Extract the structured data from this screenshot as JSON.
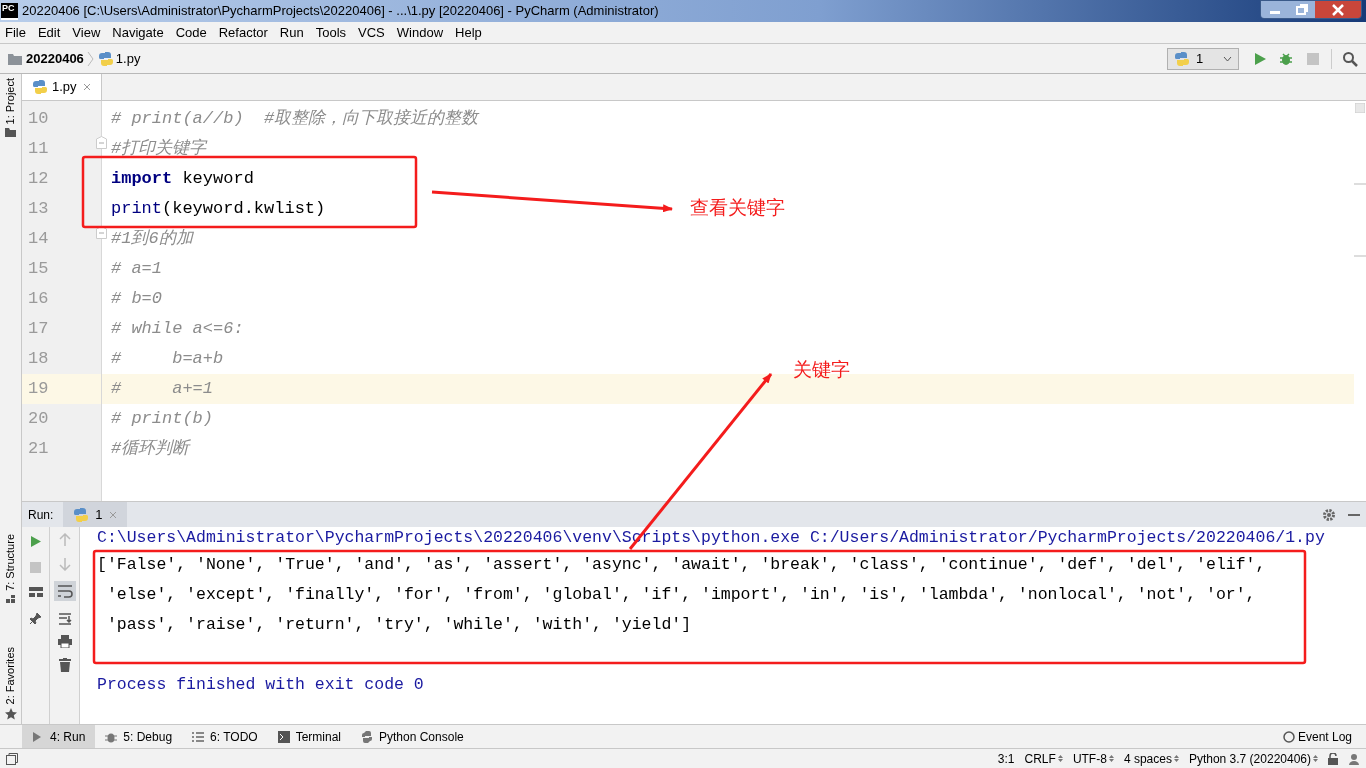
{
  "window": {
    "title": "20220406 [C:\\Users\\Administrator\\PycharmProjects\\20220406] - ...\\1.py [20220406] - PyCharm (Administrator)",
    "app_badge": "PC"
  },
  "menu": [
    "File",
    "Edit",
    "View",
    "Navigate",
    "Code",
    "Refactor",
    "Run",
    "Tools",
    "VCS",
    "Window",
    "Help"
  ],
  "breadcrumb": [
    "20220406",
    "1.py"
  ],
  "run_config": "1",
  "side_tabs_left": [
    {
      "label": "1: Project"
    },
    {
      "label": "7: Structure"
    },
    {
      "label": "2: Favorites"
    }
  ],
  "editor_tabs": [
    {
      "label": "1.py",
      "selected": true
    }
  ],
  "editor": {
    "lines": [
      {
        "number": "10",
        "current": false,
        "fold": false,
        "tokens": [
          {
            "kind": "comment",
            "text": "# print(a//b)  #取整除，向下取接近的整数"
          }
        ]
      },
      {
        "number": "11",
        "current": false,
        "fold": true,
        "tokens": [
          {
            "kind": "comment",
            "text": "#打印关键字"
          }
        ]
      },
      {
        "number": "12",
        "current": false,
        "fold": false,
        "tokens": [
          {
            "kind": "keyword",
            "text": "import"
          },
          {
            "kind": "plain",
            "text": " keyword"
          }
        ]
      },
      {
        "number": "13",
        "current": false,
        "fold": false,
        "tokens": [
          {
            "kind": "builtin",
            "text": "print"
          },
          {
            "kind": "plain",
            "text": "(keyword.kwlist)"
          }
        ]
      },
      {
        "number": "14",
        "current": false,
        "fold": true,
        "tokens": [
          {
            "kind": "comment",
            "text": "#1到6的加"
          }
        ]
      },
      {
        "number": "15",
        "current": false,
        "fold": false,
        "tokens": [
          {
            "kind": "comment",
            "text": "# a=1"
          }
        ]
      },
      {
        "number": "16",
        "current": false,
        "fold": false,
        "tokens": [
          {
            "kind": "comment",
            "text": "# b=0"
          }
        ]
      },
      {
        "number": "17",
        "current": false,
        "fold": false,
        "tokens": [
          {
            "kind": "comment",
            "text": "# while a<=6:"
          }
        ]
      },
      {
        "number": "18",
        "current": false,
        "fold": false,
        "tokens": [
          {
            "kind": "comment",
            "text": "#     b=a+b"
          }
        ]
      },
      {
        "number": "19",
        "current": true,
        "fold": false,
        "tokens": [
          {
            "kind": "comment",
            "text": "#     a+=1"
          }
        ]
      },
      {
        "number": "20",
        "current": false,
        "fold": false,
        "tokens": [
          {
            "kind": "comment",
            "text": "# print(b)"
          }
        ]
      },
      {
        "number": "21",
        "current": false,
        "fold": false,
        "tokens": [
          {
            "kind": "comment",
            "text": "#循环判断"
          }
        ]
      }
    ]
  },
  "run_panel": {
    "label": "Run:",
    "tabs": [
      {
        "label": "1",
        "selected": true
      }
    ],
    "console": [
      {
        "kind": "command",
        "text": "C:\\Users\\Administrator\\PycharmProjects\\20220406\\venv\\Scripts\\python.exe C:/Users/Administrator/PycharmProjects/20220406/1.py"
      },
      {
        "kind": "output",
        "text": "['False', 'None', 'True', 'and', 'as', 'assert', 'async', 'await', 'break', 'class', 'continue', 'def', 'del', 'elif',"
      },
      {
        "kind": "output",
        "text": " 'else', 'except', 'finally', 'for', 'from', 'global', 'if', 'import', 'in', 'is', 'lambda', 'nonlocal', 'not', 'or',"
      },
      {
        "kind": "output",
        "text": " 'pass', 'raise', 'return', 'try', 'while', 'with', 'yield']"
      },
      {
        "kind": "blank"
      },
      {
        "kind": "exit",
        "text": "Process finished with exit code 0"
      }
    ]
  },
  "tool_tabs": [
    {
      "label": "4: Run",
      "selected": true
    },
    {
      "label": "5: Debug",
      "selected": false
    },
    {
      "label": "6: TODO",
      "selected": false
    },
    {
      "label": "Terminal",
      "selected": false
    },
    {
      "label": "Python Console",
      "selected": false
    }
  ],
  "event_log": "Event Log",
  "status_bar": [
    "3:1",
    "CRLF",
    "UTF-8",
    "4 spaces",
    "Python 3.7 (20220406)"
  ],
  "callouts": [
    {
      "text": "查看关键字"
    },
    {
      "text": "关键字"
    }
  ]
}
